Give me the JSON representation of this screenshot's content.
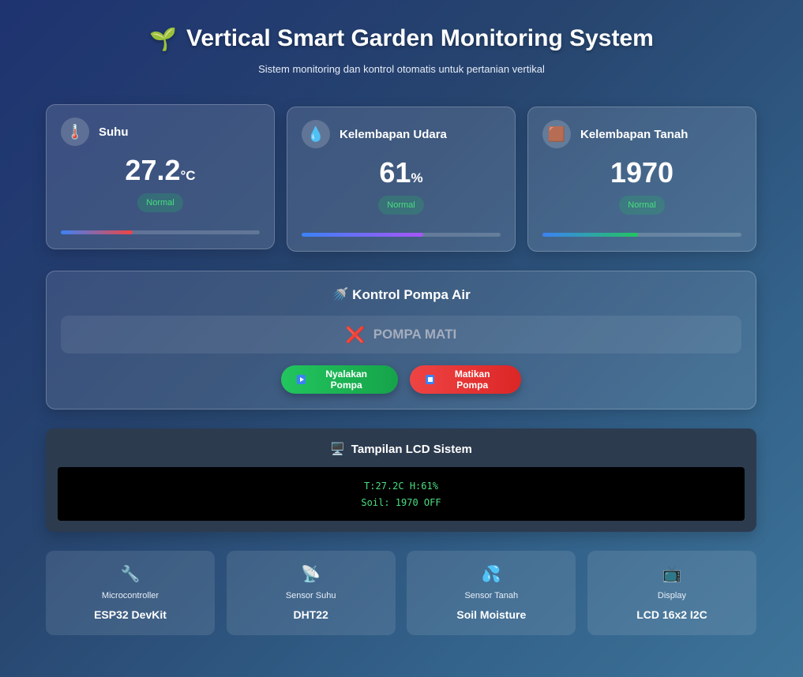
{
  "header": {
    "icon": "seedling",
    "icon_glyph": "🌱",
    "title": "Vertical Smart Garden Monitoring System",
    "subtitle": "Sistem monitoring dan kontrol otomatis untuk pertanian vertikal"
  },
  "sensors": [
    {
      "icon": "thermometer",
      "icon_glyph": "🌡️",
      "label": "Suhu",
      "value": "27.2",
      "unit": "°C",
      "status": "Normal",
      "level_percent": 36,
      "bar_colors": [
        "#3b82f6",
        "#ef4444"
      ]
    },
    {
      "icon": "droplet",
      "icon_glyph": "💧",
      "label": "Kelembapan Udara",
      "value": "61",
      "unit": "%",
      "status": "Normal",
      "level_percent": 61,
      "bar_colors": [
        "#3b82f6",
        "#a855f7"
      ]
    },
    {
      "icon": "soil",
      "icon_glyph": "🟫",
      "label": "Kelembapan Tanah",
      "value": "1970",
      "unit": "",
      "status": "Normal",
      "level_percent": 48,
      "bar_colors": [
        "#3b82f6",
        "#22c55e"
      ]
    }
  ],
  "pump": {
    "icon": "shower",
    "icon_glyph": "🚿",
    "title": "Kontrol Pompa Air",
    "status_icon": "cross-mark",
    "status_glyph": "❌",
    "status_text": "POMPA MATI",
    "on_button": "Nyalakan Pompa",
    "off_button": "Matikan Pompa"
  },
  "lcd": {
    "icon": "desktop-computer",
    "icon_glyph": "🖥️",
    "title": "Tampilan LCD Sistem",
    "line1": "T:27.2C H:61%",
    "line2": "Soil: 1970 OFF"
  },
  "info": [
    {
      "icon": "wrench",
      "icon_glyph": "🔧",
      "label": "Microcontroller",
      "value": "ESP32 DevKit"
    },
    {
      "icon": "satellite-antenna",
      "icon_glyph": "📡",
      "label": "Sensor Suhu",
      "value": "DHT22"
    },
    {
      "icon": "sweat-droplets",
      "icon_glyph": "💦",
      "label": "Sensor Tanah",
      "value": "Soil Moisture"
    },
    {
      "icon": "television",
      "icon_glyph": "📺",
      "label": "Display",
      "value": "LCD 16x2 I2C"
    }
  ],
  "colors": {
    "status_ok": "#4ade80",
    "button_on": "#22c55e",
    "button_off": "#ef4444",
    "lcd_text": "#4ade80"
  }
}
